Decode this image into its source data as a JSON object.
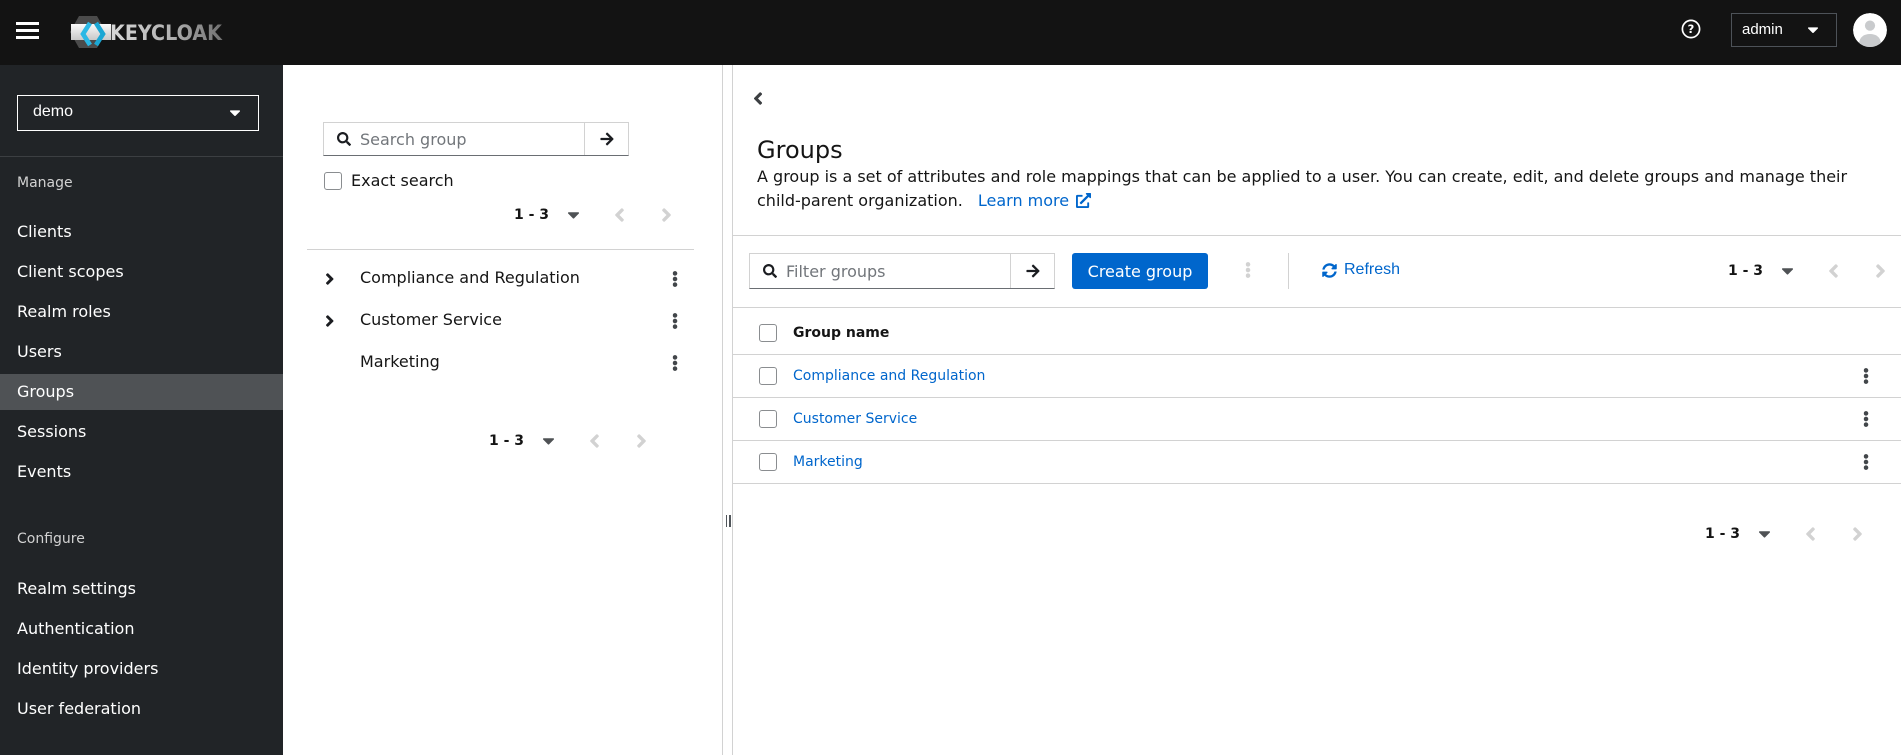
{
  "colors": {
    "primary": "#0066cc",
    "masthead_bg": "#131313",
    "sidebar_bg": "#212427",
    "sidebar_selected_bg": "#4f5255",
    "link": "#0066cc",
    "border": "#d2d2d2",
    "text": "#151515"
  },
  "masthead": {
    "brand": "KEYCLOAK",
    "help_icon": "question-circle-icon",
    "user_menu": {
      "label": "admin"
    }
  },
  "sidebar": {
    "realm_selector": {
      "value": "demo"
    },
    "sections": [
      {
        "label": "Manage",
        "items": [
          {
            "label": "Clients"
          },
          {
            "label": "Client scopes"
          },
          {
            "label": "Realm roles"
          },
          {
            "label": "Users"
          },
          {
            "label": "Groups",
            "current": true
          },
          {
            "label": "Sessions"
          },
          {
            "label": "Events"
          }
        ]
      },
      {
        "label": "Configure",
        "items": [
          {
            "label": "Realm settings"
          },
          {
            "label": "Authentication"
          },
          {
            "label": "Identity providers"
          },
          {
            "label": "User federation"
          }
        ]
      }
    ]
  },
  "tree_panel": {
    "search": {
      "placeholder": "Search group"
    },
    "exact_search_label": "Exact search",
    "pagination_top": {
      "range": "1 - 3"
    },
    "items": [
      {
        "label": "Compliance and Regulation",
        "expandable": true
      },
      {
        "label": "Customer Service",
        "expandable": true
      },
      {
        "label": "Marketing",
        "expandable": false
      }
    ],
    "pagination_bottom": {
      "range": "1 - 3"
    }
  },
  "main": {
    "title": "Groups",
    "description": "A group is a set of attributes and role mappings that can be applied to a user. You can create, edit, and delete groups and manage their child-parent organization.",
    "learn_more_label": "Learn more",
    "toolbar": {
      "filter": {
        "placeholder": "Filter groups"
      },
      "create_button_label": "Create group",
      "refresh_label": "Refresh",
      "pagination": {
        "range": "1 - 3"
      }
    },
    "table": {
      "columns": [
        "Group name"
      ],
      "rows": [
        {
          "name": "Compliance and Regulation"
        },
        {
          "name": "Customer Service"
        },
        {
          "name": "Marketing"
        }
      ]
    },
    "pagination_bottom": {
      "range": "1 - 3"
    }
  }
}
